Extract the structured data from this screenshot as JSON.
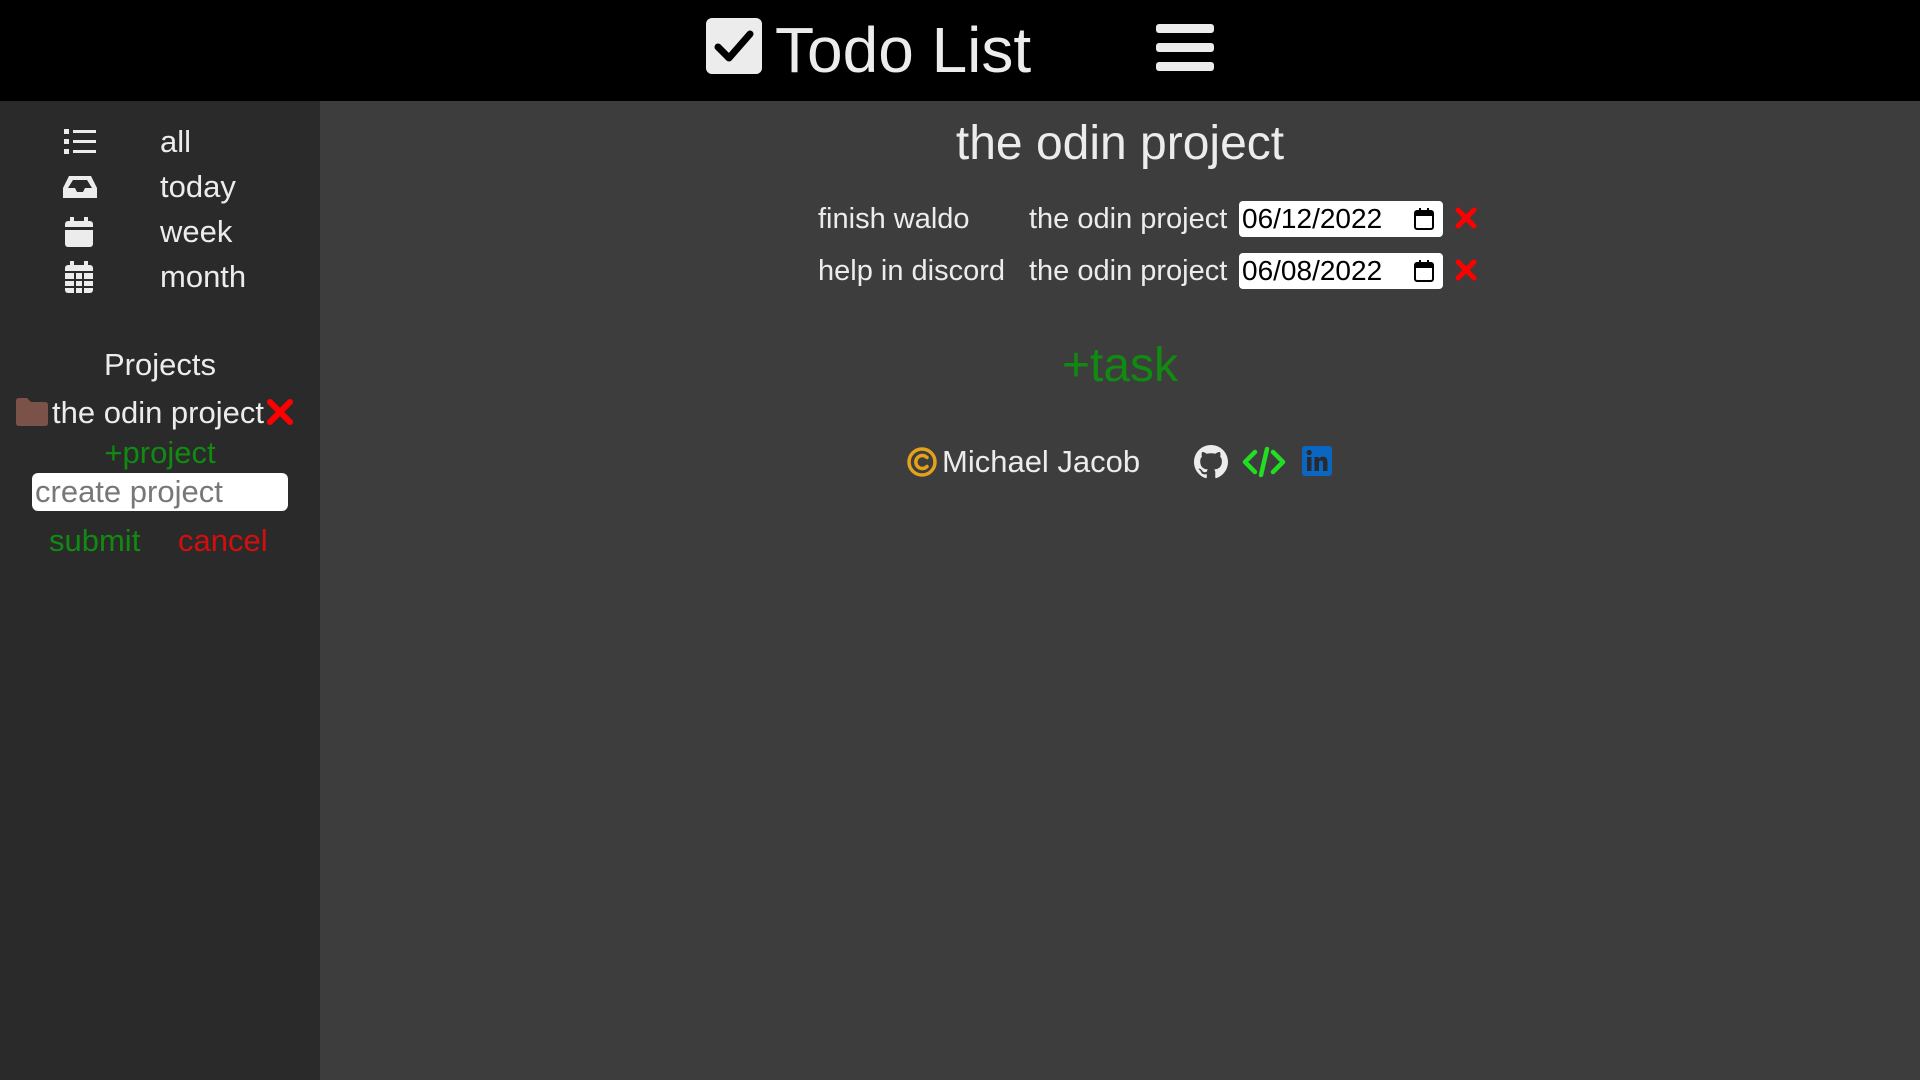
{
  "header": {
    "title": "Todo List",
    "logo_icon": "checkbox-icon",
    "menu_icon": "hamburger-menu-icon"
  },
  "sidebar": {
    "nav": [
      {
        "label": "all",
        "icon": "list-icon"
      },
      {
        "label": "today",
        "icon": "inbox-icon"
      },
      {
        "label": "week",
        "icon": "calendar-week-icon"
      },
      {
        "label": "month",
        "icon": "calendar-month-icon"
      }
    ],
    "projects_heading": "Projects",
    "projects": [
      {
        "name": "the odin project",
        "icon": "folder-icon",
        "delete_icon": "delete-x-icon"
      }
    ],
    "add_project_label": "+project",
    "create_placeholder": "create project",
    "create_value": "",
    "submit_label": "submit",
    "cancel_label": "cancel"
  },
  "main": {
    "title": "the odin project",
    "tasks": [
      {
        "name": "finish waldo",
        "project": "the odin project",
        "date": "06/12/2022"
      },
      {
        "name": "help in discord",
        "project": "the odin project",
        "date": "06/08/2022"
      }
    ],
    "add_task_label": "+task"
  },
  "footer": {
    "copyright_symbol": "©",
    "author": "Michael Jacob",
    "links": [
      "github-icon",
      "code-icon",
      "linkedin-icon"
    ]
  },
  "colors": {
    "header_bg": "#000000",
    "sidebar_bg": "#2a2a2a",
    "main_bg": "#3d3d3d",
    "add_green": "#118a11",
    "cancel_red": "#d40d0d",
    "delete_red": "#ff0000",
    "copyright_gold": "#e3a21a",
    "code_green": "#22dd22",
    "linkedin_blue": "#0a66c2",
    "folder_brown": "#7a5248"
  }
}
